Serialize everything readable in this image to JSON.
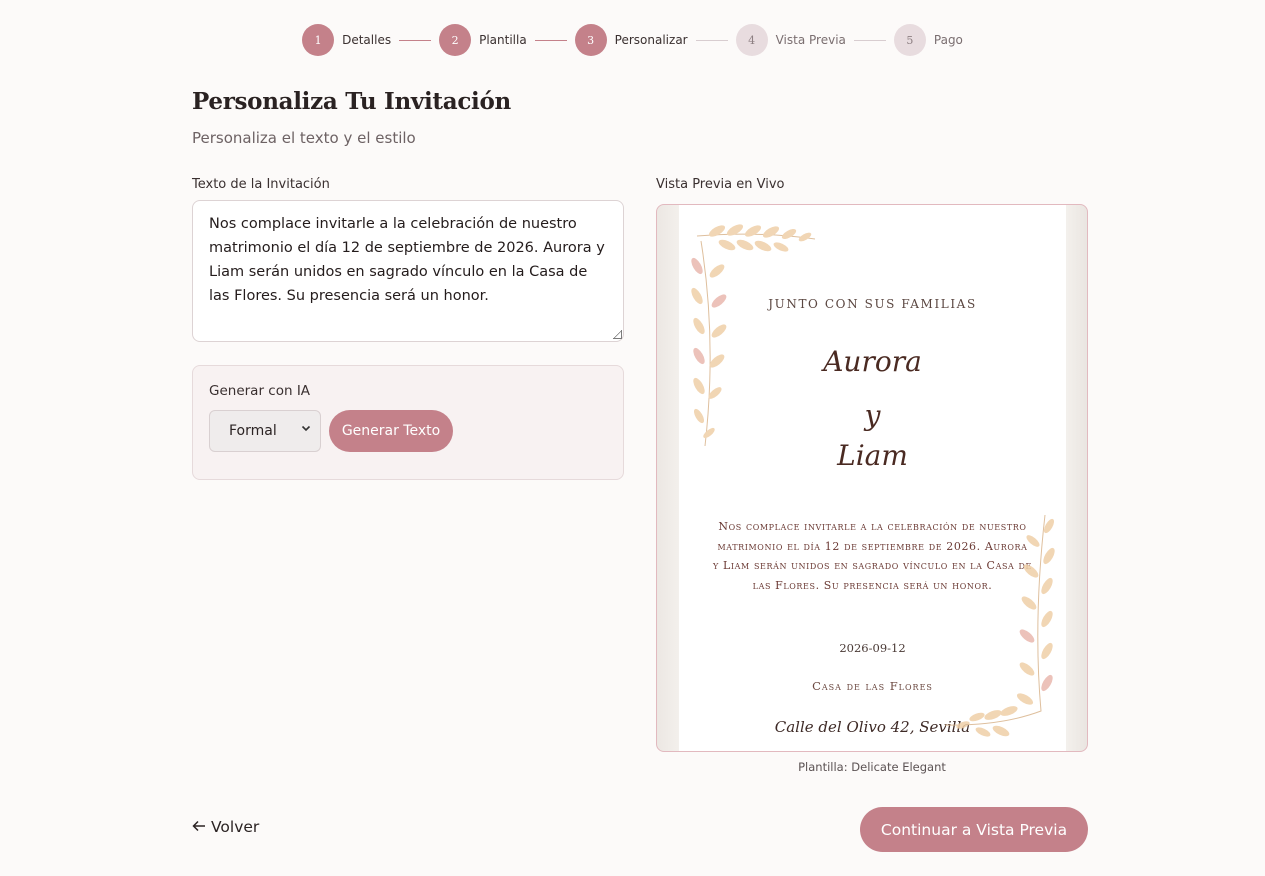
{
  "stepper": {
    "steps": [
      {
        "number": "1",
        "label": "Detalles",
        "state": "done"
      },
      {
        "number": "2",
        "label": "Plantilla",
        "state": "done"
      },
      {
        "number": "3",
        "label": "Personalizar",
        "state": "done"
      },
      {
        "number": "4",
        "label": "Vista Previa",
        "state": "todo"
      },
      {
        "number": "5",
        "label": "Pago",
        "state": "todo"
      }
    ]
  },
  "header": {
    "title": "Personaliza Tu Invitación",
    "subtitle": "Personaliza el texto y el estilo"
  },
  "editor": {
    "text_label": "Texto de la Invitación",
    "text_value": "Nos complace invitarle a la celebración de nuestro matrimonio el día 12 de septiembre de 2026. Aurora y Liam serán unidos en sagrado vínculo en la Casa de las Flores. Su presencia será un honor."
  },
  "ai": {
    "title": "Generar con IA",
    "tone_selected": "Formal",
    "generate_label": "Generar Texto"
  },
  "preview": {
    "label": "Vista Previa en Vivo",
    "families": "JUNTO CON SUS FAMILIAS",
    "name1": "Aurora",
    "conjunction": "y",
    "name2": "Liam",
    "body": "Nos complace invitarle a la celebración de nuestro matrimonio el día 12 de septiembre de 2026. Aurora y Liam serán unidos en sagrado vínculo en la Casa de las Flores. Su presencia será un honor.",
    "date": "2026-09-12",
    "venue": "Casa de las Flores",
    "address": "Calle del Olivo 42, Sevilla",
    "caption": "Plantilla: Delicate Elegant"
  },
  "footer": {
    "back_label": "Volver",
    "continue_label": "Continuar a Vista Previa"
  },
  "colors": {
    "accent": "#c4818a",
    "background": "#fcfaf9",
    "step_inactive": "#e8dcdf"
  },
  "icons": {
    "back": "arrow-left-icon",
    "select": "chevron-down-icon"
  }
}
